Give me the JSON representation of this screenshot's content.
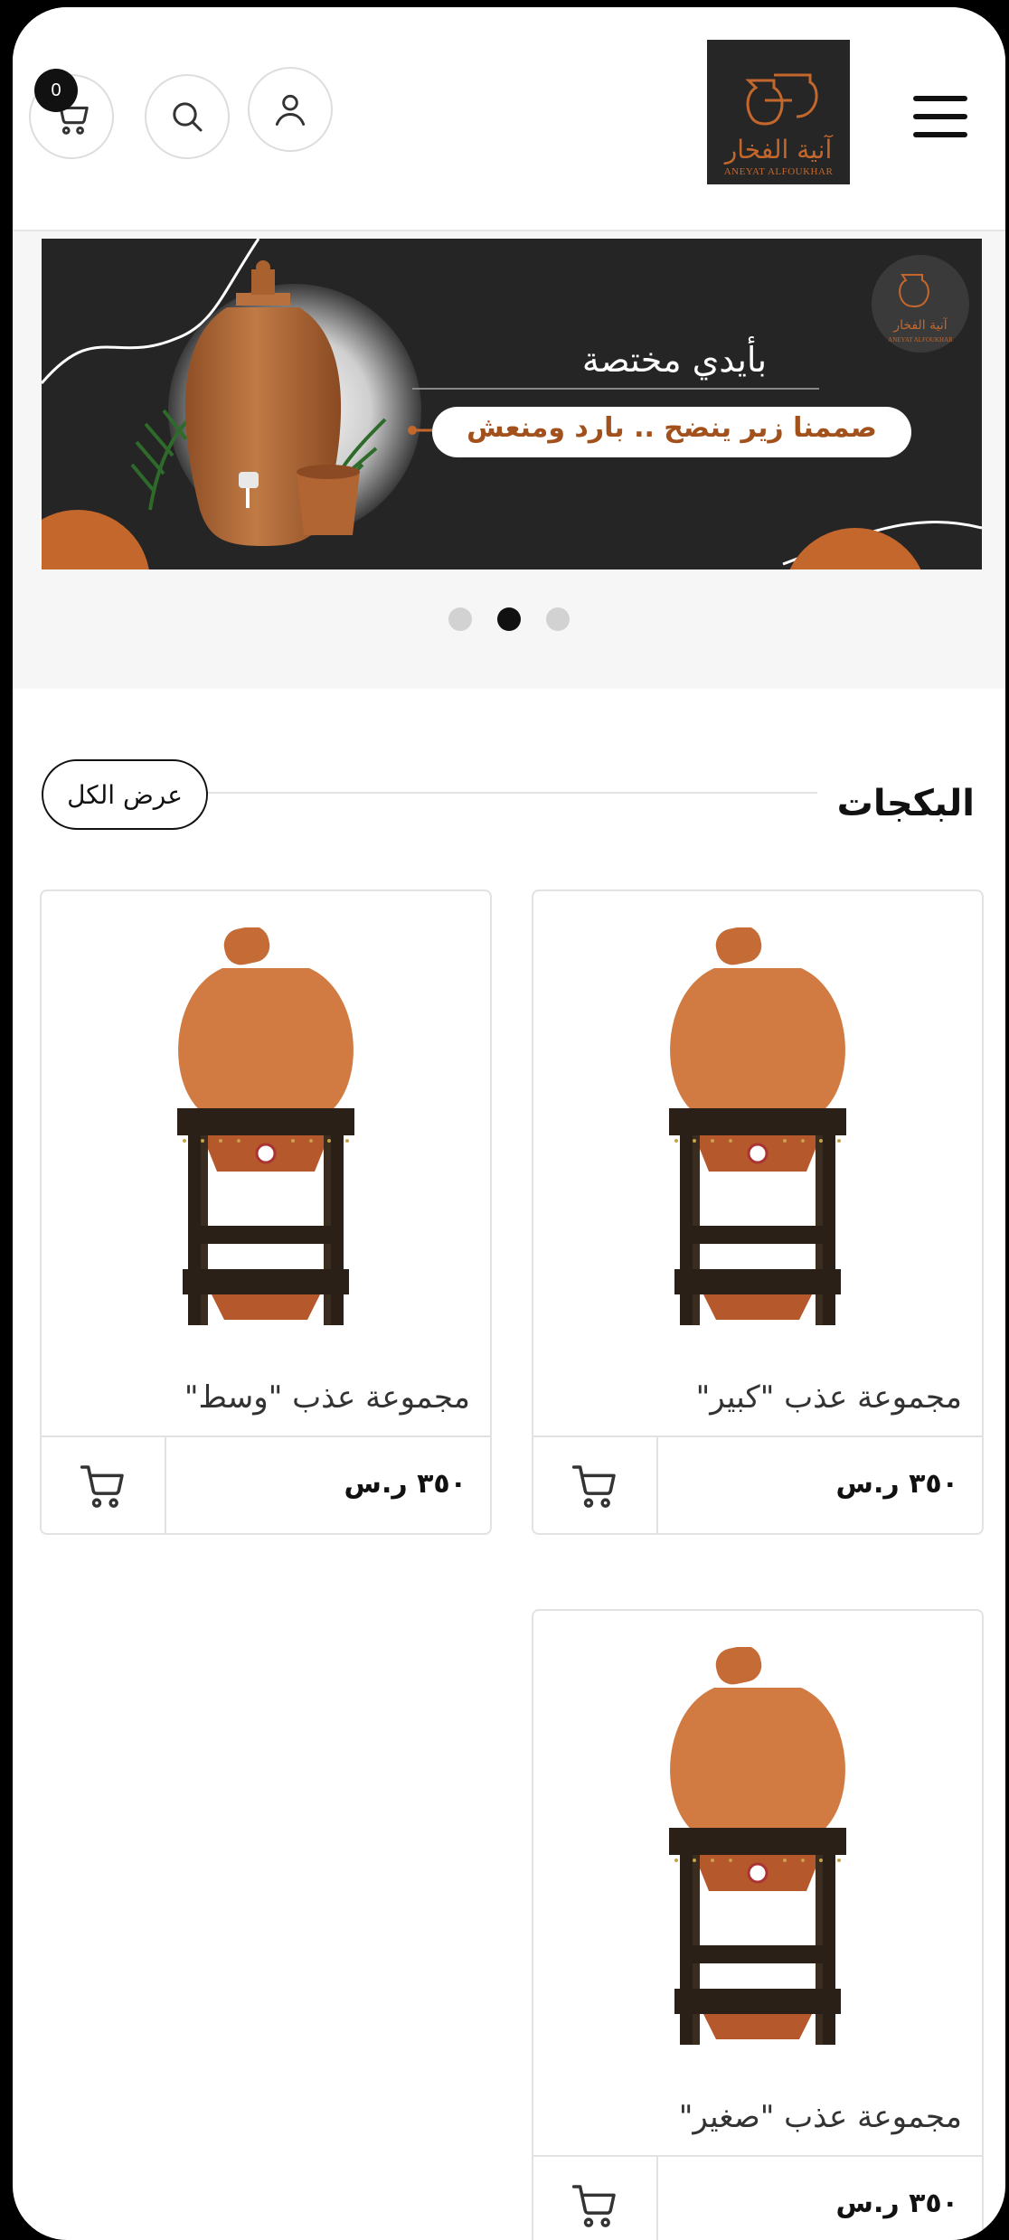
{
  "header": {
    "cart_count": "0",
    "logo_ar": "آنية الفخار",
    "logo_en": "ANEYAT ALFOUKHAR"
  },
  "banner": {
    "headline": "بأيدي مختصة",
    "tagline": "صممنا زير ينضح .. بارد ومنعش",
    "logo_small_ar": "آنية الفخار",
    "logo_small_en": "ANEYAT ALFOUKHAR",
    "slides_total": 3,
    "active_slide": 2,
    "colors": {
      "background": "#252525",
      "accent": "#c4672d",
      "clay": "#b8703e"
    }
  },
  "section": {
    "title": "البكجات",
    "view_all_label": "عرض الكل"
  },
  "products": [
    {
      "name": "مجموعة عذب \"كبير\"",
      "price": "٣٥٠ ر.س"
    },
    {
      "name": "مجموعة عذب \"وسط\"",
      "price": "٣٥٠ ر.س"
    },
    {
      "name": "مجموعة عذب \"صغير\"",
      "price": "٣٥٠ ر.س"
    }
  ],
  "icons": [
    "cart-icon",
    "search-icon",
    "user-icon",
    "menu-icon"
  ]
}
